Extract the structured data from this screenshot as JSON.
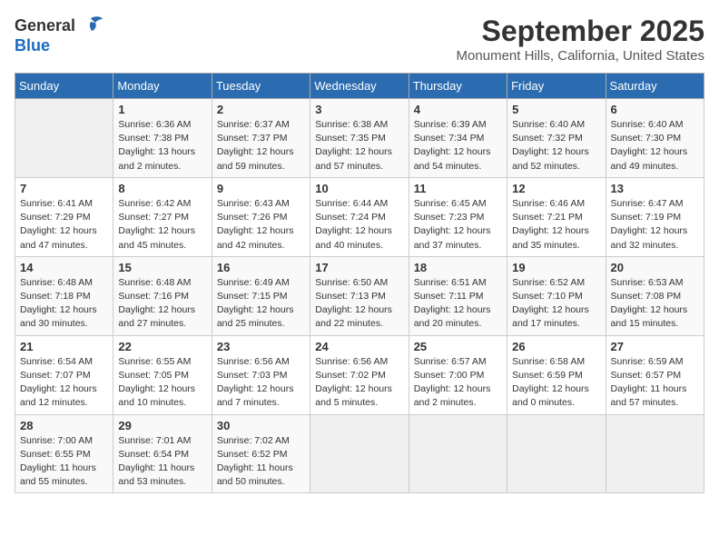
{
  "logo": {
    "general": "General",
    "blue": "Blue"
  },
  "title": "September 2025",
  "subtitle": "Monument Hills, California, United States",
  "days_of_week": [
    "Sunday",
    "Monday",
    "Tuesday",
    "Wednesday",
    "Thursday",
    "Friday",
    "Saturday"
  ],
  "weeks": [
    [
      {
        "day": "",
        "info": ""
      },
      {
        "day": "1",
        "info": "Sunrise: 6:36 AM\nSunset: 7:38 PM\nDaylight: 13 hours\nand 2 minutes."
      },
      {
        "day": "2",
        "info": "Sunrise: 6:37 AM\nSunset: 7:37 PM\nDaylight: 12 hours\nand 59 minutes."
      },
      {
        "day": "3",
        "info": "Sunrise: 6:38 AM\nSunset: 7:35 PM\nDaylight: 12 hours\nand 57 minutes."
      },
      {
        "day": "4",
        "info": "Sunrise: 6:39 AM\nSunset: 7:34 PM\nDaylight: 12 hours\nand 54 minutes."
      },
      {
        "day": "5",
        "info": "Sunrise: 6:40 AM\nSunset: 7:32 PM\nDaylight: 12 hours\nand 52 minutes."
      },
      {
        "day": "6",
        "info": "Sunrise: 6:40 AM\nSunset: 7:30 PM\nDaylight: 12 hours\nand 49 minutes."
      }
    ],
    [
      {
        "day": "7",
        "info": "Sunrise: 6:41 AM\nSunset: 7:29 PM\nDaylight: 12 hours\nand 47 minutes."
      },
      {
        "day": "8",
        "info": "Sunrise: 6:42 AM\nSunset: 7:27 PM\nDaylight: 12 hours\nand 45 minutes."
      },
      {
        "day": "9",
        "info": "Sunrise: 6:43 AM\nSunset: 7:26 PM\nDaylight: 12 hours\nand 42 minutes."
      },
      {
        "day": "10",
        "info": "Sunrise: 6:44 AM\nSunset: 7:24 PM\nDaylight: 12 hours\nand 40 minutes."
      },
      {
        "day": "11",
        "info": "Sunrise: 6:45 AM\nSunset: 7:23 PM\nDaylight: 12 hours\nand 37 minutes."
      },
      {
        "day": "12",
        "info": "Sunrise: 6:46 AM\nSunset: 7:21 PM\nDaylight: 12 hours\nand 35 minutes."
      },
      {
        "day": "13",
        "info": "Sunrise: 6:47 AM\nSunset: 7:19 PM\nDaylight: 12 hours\nand 32 minutes."
      }
    ],
    [
      {
        "day": "14",
        "info": "Sunrise: 6:48 AM\nSunset: 7:18 PM\nDaylight: 12 hours\nand 30 minutes."
      },
      {
        "day": "15",
        "info": "Sunrise: 6:48 AM\nSunset: 7:16 PM\nDaylight: 12 hours\nand 27 minutes."
      },
      {
        "day": "16",
        "info": "Sunrise: 6:49 AM\nSunset: 7:15 PM\nDaylight: 12 hours\nand 25 minutes."
      },
      {
        "day": "17",
        "info": "Sunrise: 6:50 AM\nSunset: 7:13 PM\nDaylight: 12 hours\nand 22 minutes."
      },
      {
        "day": "18",
        "info": "Sunrise: 6:51 AM\nSunset: 7:11 PM\nDaylight: 12 hours\nand 20 minutes."
      },
      {
        "day": "19",
        "info": "Sunrise: 6:52 AM\nSunset: 7:10 PM\nDaylight: 12 hours\nand 17 minutes."
      },
      {
        "day": "20",
        "info": "Sunrise: 6:53 AM\nSunset: 7:08 PM\nDaylight: 12 hours\nand 15 minutes."
      }
    ],
    [
      {
        "day": "21",
        "info": "Sunrise: 6:54 AM\nSunset: 7:07 PM\nDaylight: 12 hours\nand 12 minutes."
      },
      {
        "day": "22",
        "info": "Sunrise: 6:55 AM\nSunset: 7:05 PM\nDaylight: 12 hours\nand 10 minutes."
      },
      {
        "day": "23",
        "info": "Sunrise: 6:56 AM\nSunset: 7:03 PM\nDaylight: 12 hours\nand 7 minutes."
      },
      {
        "day": "24",
        "info": "Sunrise: 6:56 AM\nSunset: 7:02 PM\nDaylight: 12 hours\nand 5 minutes."
      },
      {
        "day": "25",
        "info": "Sunrise: 6:57 AM\nSunset: 7:00 PM\nDaylight: 12 hours\nand 2 minutes."
      },
      {
        "day": "26",
        "info": "Sunrise: 6:58 AM\nSunset: 6:59 PM\nDaylight: 12 hours\nand 0 minutes."
      },
      {
        "day": "27",
        "info": "Sunrise: 6:59 AM\nSunset: 6:57 PM\nDaylight: 11 hours\nand 57 minutes."
      }
    ],
    [
      {
        "day": "28",
        "info": "Sunrise: 7:00 AM\nSunset: 6:55 PM\nDaylight: 11 hours\nand 55 minutes."
      },
      {
        "day": "29",
        "info": "Sunrise: 7:01 AM\nSunset: 6:54 PM\nDaylight: 11 hours\nand 53 minutes."
      },
      {
        "day": "30",
        "info": "Sunrise: 7:02 AM\nSunset: 6:52 PM\nDaylight: 11 hours\nand 50 minutes."
      },
      {
        "day": "",
        "info": ""
      },
      {
        "day": "",
        "info": ""
      },
      {
        "day": "",
        "info": ""
      },
      {
        "day": "",
        "info": ""
      }
    ]
  ]
}
